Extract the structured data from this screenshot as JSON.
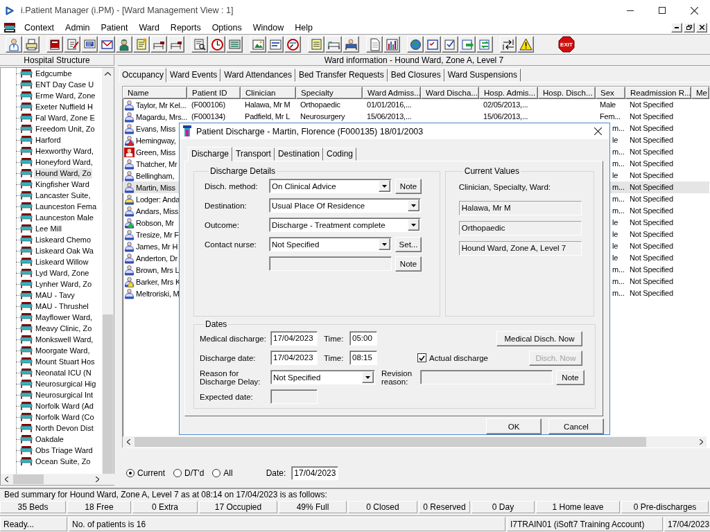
{
  "window": {
    "title": "i.Patient Manager (i.PM) - [Ward Management View : 1]"
  },
  "menu": [
    "Context",
    "Admin",
    "Patient",
    "Ward",
    "Reports",
    "Options",
    "Window",
    "Help"
  ],
  "toolbar": {
    "exit_label": "EXIT"
  },
  "sidebar": {
    "title": "Hospital Structure",
    "items": [
      {
        "label": "Edgcumbe",
        "selected": false
      },
      {
        "label": "ENT Day Case U",
        "selected": false
      },
      {
        "label": "Erme Ward, Zone",
        "selected": false
      },
      {
        "label": "Exeter Nuffield H",
        "selected": false
      },
      {
        "label": "Fal Ward, Zone E",
        "selected": false
      },
      {
        "label": "Freedom Unit, Zo",
        "selected": false
      },
      {
        "label": "Harford",
        "selected": false
      },
      {
        "label": "Hexworthy Ward,",
        "selected": false
      },
      {
        "label": "Honeyford Ward,",
        "selected": false
      },
      {
        "label": "Hound Ward, Zo",
        "selected": true
      },
      {
        "label": "Kingfisher Ward",
        "selected": false
      },
      {
        "label": "Lancaster Suite,",
        "selected": false
      },
      {
        "label": "Launceston Fema",
        "selected": false
      },
      {
        "label": "Launceston Male",
        "selected": false
      },
      {
        "label": "Lee Mill",
        "selected": false
      },
      {
        "label": "Liskeard Chemo",
        "selected": false
      },
      {
        "label": "Liskeard Oak Wa",
        "selected": false
      },
      {
        "label": "Liskeard Willow",
        "selected": false
      },
      {
        "label": "Lyd Ward, Zone",
        "selected": false
      },
      {
        "label": "Lynher Ward, Zo",
        "selected": false
      },
      {
        "label": "MAU - Tavy",
        "selected": false
      },
      {
        "label": "MAU - Thrushel",
        "selected": false
      },
      {
        "label": "Mayflower Ward,",
        "selected": false
      },
      {
        "label": "Meavy Clinic, Zo",
        "selected": false
      },
      {
        "label": "Monkswell Ward,",
        "selected": false
      },
      {
        "label": "Moorgate Ward,",
        "selected": false
      },
      {
        "label": "Mount Stuart Hos",
        "selected": false
      },
      {
        "label": "Neonatal ICU (N",
        "selected": false
      },
      {
        "label": "Neurosurgical Hig",
        "selected": false
      },
      {
        "label": "Neurosurgical Int",
        "selected": false
      },
      {
        "label": "Norfolk Ward (Ad",
        "selected": false
      },
      {
        "label": "Norfolk Ward (Co",
        "selected": false
      },
      {
        "label": "North Devon Dist",
        "selected": false
      },
      {
        "label": "Oakdale",
        "selected": false
      },
      {
        "label": "Obs Triage Ward",
        "selected": false
      },
      {
        "label": "Ocean Suite, Zo",
        "selected": false
      }
    ]
  },
  "ward": {
    "header": "Ward information - Hound Ward, Zone A, Level 7",
    "tabs": [
      {
        "label": "Occupancy",
        "selected": true
      },
      {
        "label": "Ward Events",
        "selected": false
      },
      {
        "label": "Ward Attendances",
        "selected": false
      },
      {
        "label": "Bed Transfer Requests",
        "selected": false
      },
      {
        "label": "Bed Closures",
        "selected": false
      },
      {
        "label": "Ward Suspensions",
        "selected": false
      }
    ],
    "table": {
      "columns": [
        "Name",
        "Patient ID",
        "Clinician",
        "Specialty",
        "Ward Admiss...",
        "Ward Discha...",
        "Hosp. Admis...",
        "Hosp. Disch...",
        "Sex",
        "Readmission R...",
        "Me"
      ],
      "rows": [
        {
          "kind": "patient",
          "selected": false,
          "name": "Taylor, Mr Kel...",
          "patient_id": "(F000106)",
          "clinician": "Halawa, Mr M",
          "specialty": "Orthopaedic",
          "ward_admission": "01/01/2016,...",
          "hosp_admission": "02/05/2013,...",
          "sex": "Male",
          "readmission": "Not Specified"
        },
        {
          "kind": "patient",
          "selected": false,
          "name": "Magardu, Mrs...",
          "patient_id": "(F000134)",
          "clinician": "Padfield, Mr L",
          "specialty": "Neurosurgery",
          "ward_admission": "15/06/2013,...",
          "hosp_admission": "15/06/2013,...",
          "sex": "Fem...",
          "readmission": "Not Specified"
        },
        {
          "kind": "patient",
          "selected": false,
          "name": "Evans, Miss",
          "sex": "m...",
          "readmission": "Not Specified"
        },
        {
          "kind": "red-alert",
          "selected": false,
          "name": "Hemingway,",
          "sex": "le",
          "readmission": "Not Specified"
        },
        {
          "kind": "isolation",
          "selected": false,
          "name": "Green, Miss",
          "sex": "m...",
          "readmission": "Not Specified"
        },
        {
          "kind": "patient",
          "selected": false,
          "name": "Thatcher, Mr",
          "sex": "m...",
          "readmission": "Not Specified"
        },
        {
          "kind": "patient",
          "selected": false,
          "name": "Bellingham,",
          "sex": "le",
          "readmission": "Not Specified"
        },
        {
          "kind": "patient",
          "selected": true,
          "name": "Martin, Miss",
          "sex": "m...",
          "readmission": "Not Specified"
        },
        {
          "kind": "lodger",
          "selected": false,
          "name": "Lodger: Anda",
          "sex": "m...",
          "readmission": "Not Specified"
        },
        {
          "kind": "patient",
          "selected": false,
          "name": "Andars, Miss",
          "sex": "m...",
          "readmission": "Not Specified"
        },
        {
          "kind": "green-alert",
          "selected": false,
          "name": "Robson, Mr",
          "sex": "le",
          "readmission": "Not Specified"
        },
        {
          "kind": "patient",
          "selected": false,
          "name": "Tresize, Mr F",
          "sex": "le",
          "readmission": "Not Specified"
        },
        {
          "kind": "patient",
          "selected": false,
          "name": "James, Mr H",
          "sex": "le",
          "readmission": "Not Specified"
        },
        {
          "kind": "patient",
          "selected": false,
          "name": "Anderton, Dr",
          "sex": "le",
          "readmission": "Not Specified"
        },
        {
          "kind": "patient",
          "selected": false,
          "name": "Brown, Mrs L",
          "sex": "m...",
          "readmission": "Not Specified"
        },
        {
          "kind": "yellow-alert",
          "selected": false,
          "name": "Barker, Mrs K",
          "sex": "m...",
          "readmission": "Not Specified"
        },
        {
          "kind": "patient",
          "selected": false,
          "name": "Meltroriski, M",
          "sex": "m...",
          "readmission": "Not Specified"
        }
      ]
    },
    "view_filter": [
      {
        "label": "Current",
        "selected": true
      },
      {
        "label": "D/T'd",
        "selected": false
      },
      {
        "label": "All",
        "selected": false
      }
    ],
    "date": {
      "label": "Date:",
      "value": "17/04/2023"
    }
  },
  "bed_summary": {
    "text": "Bed summary for Hound Ward, Zone A, Level 7 as at 08:14 on 17/04/2023 is as follows:",
    "counts": [
      "35 Beds",
      "18 Free",
      "0 Extra",
      "17 Occupied",
      "49% Full",
      "0 Closed",
      "0 Reserved",
      "0 Day",
      "1 Home leave",
      "0 Pre-discharges"
    ]
  },
  "status_bar": [
    "Ready...",
    "No. of patients is 16",
    "I7TRAIN01 (iSoft7 Training Account)",
    "17/04/2023"
  ],
  "dialog": {
    "title": "Patient Discharge - Martin, Florence (F000135) 18/01/2003",
    "tabs": [
      {
        "label": "Discharge",
        "selected": true
      },
      {
        "label": "Transport",
        "selected": false
      },
      {
        "label": "Destination",
        "selected": false
      },
      {
        "label": "Coding",
        "selected": false
      }
    ],
    "discharge_details": {
      "title": "Discharge Details",
      "rows": [
        {
          "kind": "combo",
          "label": "Disch. method:",
          "value": "On Clinical Advice",
          "button": "Note"
        },
        {
          "kind": "combo",
          "label": "Destination:",
          "value": "Usual Place Of Residence"
        },
        {
          "kind": "combo",
          "label": "Outcome:",
          "value": "Discharge - Treatment complete"
        },
        {
          "kind": "combo",
          "label": "Contact nurse:",
          "value": "Not Specified",
          "button": "Set..."
        },
        {
          "kind": "field",
          "disabled": true,
          "button": "Note"
        }
      ]
    },
    "current_values": {
      "title": "Current Values",
      "label": "Clinician, Specialty, Ward:",
      "values": [
        "Halawa, Mr M",
        "Orthopaedic",
        "Hound Ward, Zone A, Level 7"
      ]
    },
    "dates": {
      "title": "Dates",
      "medical_discharge": {
        "label": "Medical discharge:",
        "date": "17/04/2023",
        "time_label": "Time:",
        "time": "05:00",
        "button": {
          "label": "Medical Disch. Now",
          "disabled": false
        }
      },
      "discharge_date": {
        "label": "Discharge date:",
        "date": "17/04/2023",
        "time_label": "Time:",
        "time": "08:15",
        "checkbox": {
          "label": "Actual discharge",
          "checked": true
        },
        "button": {
          "label": "Disch. Now",
          "disabled": true
        }
      },
      "delay_reason": {
        "label": "Reason for Discharge Delay:",
        "value": "Not Specified"
      },
      "revision_reason": {
        "label": "Revision reason:",
        "disabled": true,
        "button": "Note"
      },
      "expected_date": {
        "label": "Expected date:",
        "disabled": true
      }
    },
    "buttons": [
      "OK",
      "Cancel"
    ]
  }
}
